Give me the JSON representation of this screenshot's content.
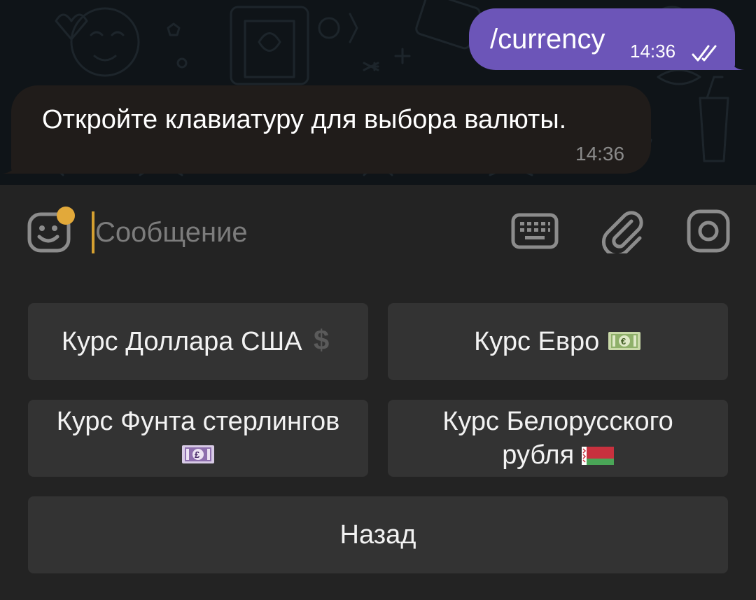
{
  "chat": {
    "outgoing": {
      "text": "/currency",
      "time": "14:36",
      "status_icon": "double-check-icon"
    },
    "incoming": {
      "text": "Откройте клавиатуру для выбора валюты.",
      "time": "14:36"
    }
  },
  "input": {
    "placeholder": "Сообщение",
    "icons": [
      "emoji-sticker-icon",
      "keyboard-icon",
      "paperclip-icon",
      "camera-icon"
    ]
  },
  "keyboard": {
    "usd": {
      "label": "Курс Доллара США",
      "emoji": "dollar-sign"
    },
    "eur": {
      "label": "Курс Евро",
      "emoji": "euro-banknote"
    },
    "gbp": {
      "label": "Курс Фунта стерлингов",
      "emoji": "pound-banknote"
    },
    "byn": {
      "label_line1": "Курс Белорусского",
      "label_line2": "рубля",
      "emoji": "flag-belarus"
    },
    "back": {
      "label": "Назад"
    }
  },
  "colors": {
    "chat_background": "#0f1418",
    "outgoing_bubble": "#6c55b8",
    "incoming_bubble": "#201c1a",
    "panel_background": "#232323",
    "button_background": "#333333",
    "accent_dot": "#e2a93a"
  }
}
